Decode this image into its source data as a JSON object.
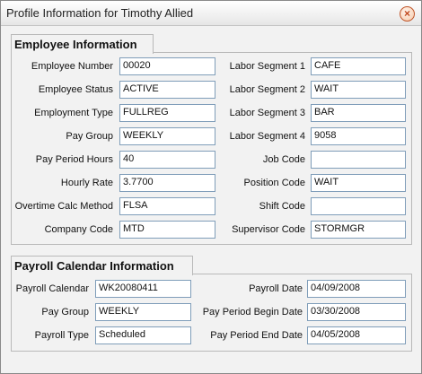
{
  "window": {
    "title": "Profile Information for Timothy Allied"
  },
  "employee": {
    "legend": "Employee Information",
    "left": [
      {
        "label": "Employee Number",
        "value": "00020"
      },
      {
        "label": "Employee Status",
        "value": "ACTIVE"
      },
      {
        "label": "Employment Type",
        "value": "FULLREG"
      },
      {
        "label": "Pay Group",
        "value": "WEEKLY"
      },
      {
        "label": "Pay Period Hours",
        "value": "40"
      },
      {
        "label": "Hourly Rate",
        "value": "3.7700"
      },
      {
        "label": "Overtime Calc Method",
        "value": "FLSA"
      },
      {
        "label": "Company Code",
        "value": "MTD"
      }
    ],
    "right": [
      {
        "label": "Labor Segment 1",
        "value": "CAFE"
      },
      {
        "label": "Labor Segment 2",
        "value": "WAIT"
      },
      {
        "label": "Labor Segment 3",
        "value": "BAR"
      },
      {
        "label": "Labor Segment 4",
        "value": "9058"
      },
      {
        "label": "Job Code",
        "value": ""
      },
      {
        "label": "Position Code",
        "value": "WAIT"
      },
      {
        "label": "Shift Code",
        "value": ""
      },
      {
        "label": "Supervisor Code",
        "value": "STORMGR"
      }
    ]
  },
  "payroll": {
    "legend": "Payroll Calendar Information",
    "left": [
      {
        "label": "Payroll Calendar",
        "value": "WK20080411"
      },
      {
        "label": "Pay Group",
        "value": "WEEKLY"
      },
      {
        "label": "Payroll Type",
        "value": "Scheduled"
      }
    ],
    "right": [
      {
        "label": "Payroll Date",
        "value": "04/09/2008"
      },
      {
        "label": "Pay Period Begin Date",
        "value": "03/30/2008"
      },
      {
        "label": "Pay Period End Date",
        "value": "04/05/2008"
      }
    ]
  }
}
